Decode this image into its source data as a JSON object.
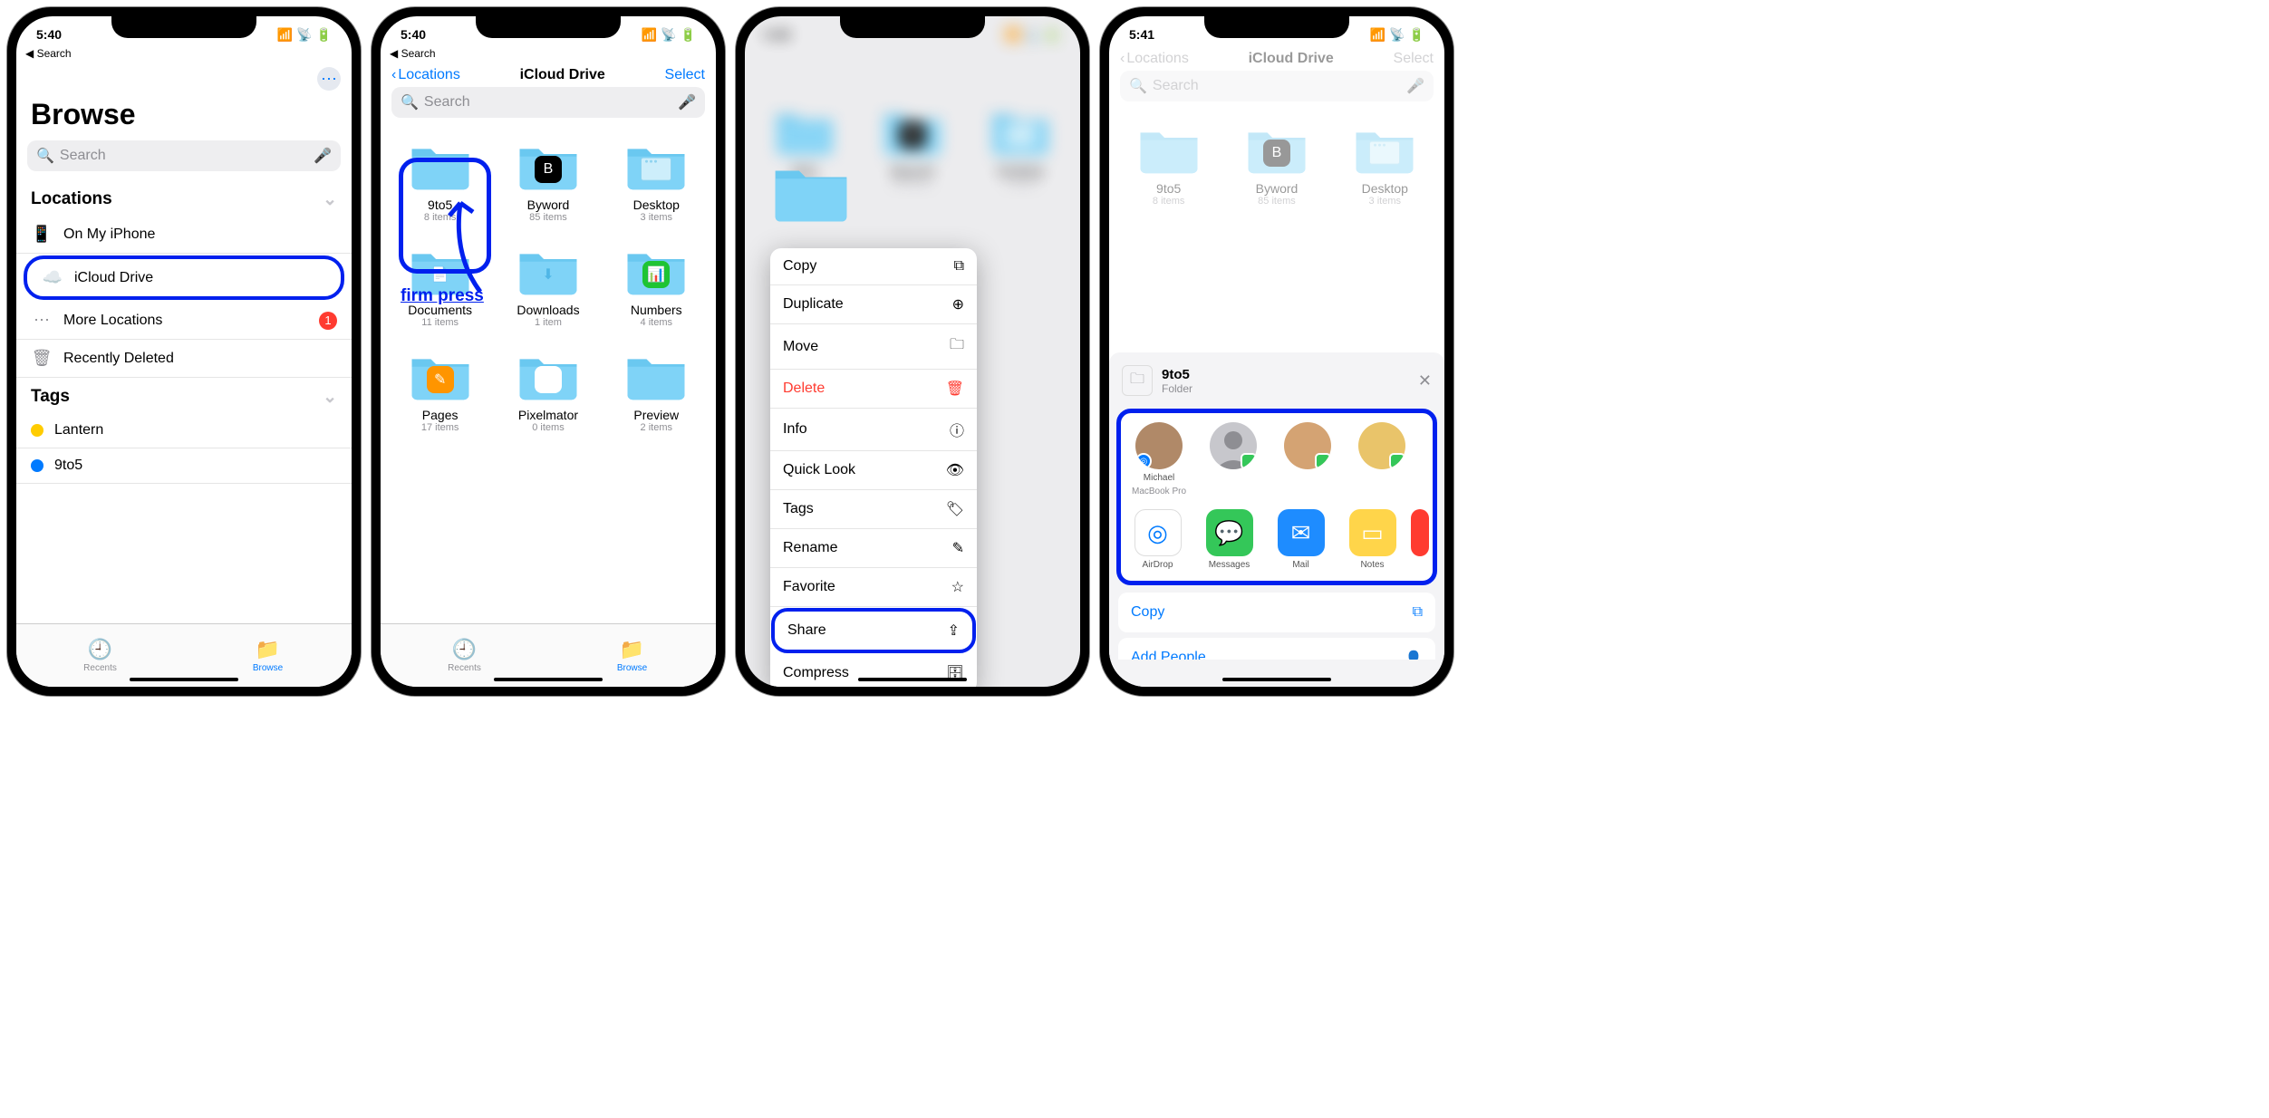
{
  "status": {
    "time1": "5:40",
    "time2": "5:40",
    "time3": "5:40",
    "time4": "5:41"
  },
  "back_search": "Search",
  "s1": {
    "title": "Browse",
    "search_placeholder": "Search",
    "locations_header": "Locations",
    "items": {
      "on_my": "On My iPhone",
      "icloud": "iCloud Drive",
      "more": "More Locations",
      "more_badge": "1",
      "deleted": "Recently Deleted"
    },
    "tags_header": "Tags",
    "tags": {
      "lantern": "Lantern",
      "nine": "9to5"
    },
    "tabs": {
      "recents": "Recents",
      "browse": "Browse"
    }
  },
  "s2": {
    "back": "Locations",
    "title": "iCloud Drive",
    "select": "Select",
    "search_placeholder": "Search",
    "annot": "firm press",
    "folders": [
      {
        "name": "9to5",
        "count": "8 items",
        "badge": null,
        "badge_bg": null
      },
      {
        "name": "Byword",
        "count": "85 items",
        "badge": "B",
        "badge_bg": "#000"
      },
      {
        "name": "Desktop",
        "count": "3 items",
        "badge": null,
        "badge_bg": null,
        "win": true
      },
      {
        "name": "Documents",
        "count": "11 items",
        "badge": "📄",
        "badge_bg": null,
        "tint": true
      },
      {
        "name": "Downloads",
        "count": "1 item",
        "badge": "⬇",
        "badge_bg": null,
        "tint": true
      },
      {
        "name": "Numbers",
        "count": "4 items",
        "badge": "📊",
        "badge_bg": "#1ec433"
      },
      {
        "name": "Pages",
        "count": "17 items",
        "badge": "✎",
        "badge_bg": "#ff9500"
      },
      {
        "name": "Pixelmator",
        "count": "0 items",
        "badge": "🖌",
        "badge_bg": "#fff"
      },
      {
        "name": "Preview",
        "count": "2 items",
        "badge": null,
        "badge_bg": null
      }
    ]
  },
  "s3": {
    "menu": [
      {
        "label": "Copy",
        "icon": "⧉",
        "red": false
      },
      {
        "label": "Duplicate",
        "icon": "⊕",
        "red": false
      },
      {
        "label": "Move",
        "icon": "🗀",
        "red": false
      },
      {
        "label": "Delete",
        "icon": "🗑",
        "red": true
      },
      {
        "label": "Info",
        "icon": "ⓘ",
        "red": false
      },
      {
        "label": "Quick Look",
        "icon": "👁",
        "red": false
      },
      {
        "label": "Tags",
        "icon": "🏷",
        "red": false
      },
      {
        "label": "Rename",
        "icon": "✎",
        "red": false
      },
      {
        "label": "Favorite",
        "icon": "☆",
        "red": false
      },
      {
        "label": "Share",
        "icon": "⇪",
        "red": false,
        "hl": true
      },
      {
        "label": "Compress",
        "icon": "🗄",
        "red": false
      }
    ]
  },
  "s4": {
    "back": "Locations",
    "title": "iCloud Drive",
    "select": "Select",
    "item_name": "9to5",
    "item_kind": "Folder",
    "airdrop_contact": {
      "name": "Michael",
      "sub": "MacBook Pro"
    },
    "apps": [
      {
        "name": "AirDrop",
        "bg": "#fff",
        "glyph": "◎",
        "fg": "#007aff"
      },
      {
        "name": "Messages",
        "bg": "#34c759",
        "glyph": "💬",
        "fg": "#fff"
      },
      {
        "name": "Mail",
        "bg": "#1e8cff",
        "glyph": "✉",
        "fg": "#fff"
      },
      {
        "name": "Notes",
        "bg": "#ffd54a",
        "glyph": "▭",
        "fg": "#fff"
      }
    ],
    "copy": "Copy",
    "add_people": "Add People"
  }
}
